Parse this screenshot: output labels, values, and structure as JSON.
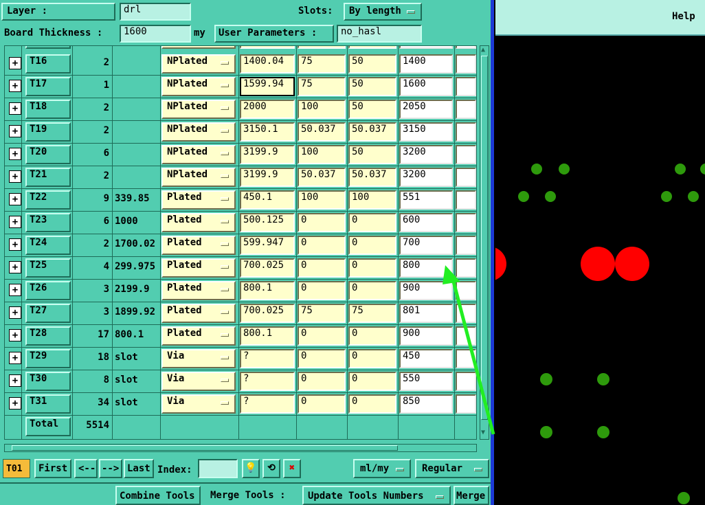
{
  "header": {
    "layer_label": "Layer     :",
    "layer_value": "drl",
    "slots_label": "Slots:",
    "slots_value": "By length",
    "board_thickness_label": "Board Thickness :",
    "board_thickness_value": "1600",
    "thickness_unit": "my",
    "user_params_label": "User Parameters :",
    "user_params_value": "no_hasl",
    "help_label": "Help"
  },
  "table": {
    "rows": [
      {
        "tool": "T16",
        "count": "2",
        "size": "",
        "type": "NPlated",
        "c1": "1400.04",
        "c2": "75",
        "c3": "50",
        "c4": "1400"
      },
      {
        "tool": "T17",
        "count": "1",
        "size": "",
        "type": "NPlated",
        "c1": "1599.94",
        "c2": "75",
        "c3": "50",
        "c4": "1600"
      },
      {
        "tool": "T18",
        "count": "2",
        "size": "",
        "type": "NPlated",
        "c1": "2000",
        "c2": "100",
        "c3": "50",
        "c4": "2050"
      },
      {
        "tool": "T19",
        "count": "2",
        "size": "",
        "type": "NPlated",
        "c1": "3150.1",
        "c2": "50.037",
        "c3": "50.037",
        "c4": "3150"
      },
      {
        "tool": "T20",
        "count": "6",
        "size": "",
        "type": "NPlated",
        "c1": "3199.9",
        "c2": "100",
        "c3": "50",
        "c4": "3200"
      },
      {
        "tool": "T21",
        "count": "2",
        "size": "",
        "type": "NPlated",
        "c1": "3199.9",
        "c2": "50.037",
        "c3": "50.037",
        "c4": "3200"
      },
      {
        "tool": "T22",
        "count": "9",
        "size": "339.85",
        "type": "Plated",
        "c1": "450.1",
        "c2": "100",
        "c3": "100",
        "c4": "551"
      },
      {
        "tool": "T23",
        "count": "6",
        "size": "1000",
        "type": "Plated",
        "c1": "500.125",
        "c2": "0",
        "c3": "0",
        "c4": "600"
      },
      {
        "tool": "T24",
        "count": "2",
        "size": "1700.02",
        "type": "Plated",
        "c1": "599.947",
        "c2": "0",
        "c3": "0",
        "c4": "700"
      },
      {
        "tool": "T25",
        "count": "4",
        "size": "299.975",
        "type": "Plated",
        "c1": "700.025",
        "c2": "0",
        "c3": "0",
        "c4": "800"
      },
      {
        "tool": "T26",
        "count": "3",
        "size": "2199.9",
        "type": "Plated",
        "c1": "800.1",
        "c2": "0",
        "c3": "0",
        "c4": "900"
      },
      {
        "tool": "T27",
        "count": "3",
        "size": "1899.92",
        "type": "Plated",
        "c1": "700.025",
        "c2": "75",
        "c3": "75",
        "c4": "801"
      },
      {
        "tool": "T28",
        "count": "17",
        "size": "800.1",
        "type": "Plated",
        "c1": "800.1",
        "c2": "0",
        "c3": "0",
        "c4": "900"
      },
      {
        "tool": "T29",
        "count": "18",
        "size": "slot",
        "type": "Via",
        "c1": "?",
        "c2": "0",
        "c3": "0",
        "c4": "450"
      },
      {
        "tool": "T30",
        "count": "8",
        "size": "slot",
        "type": "Via",
        "c1": "?",
        "c2": "0",
        "c3": "0",
        "c4": "550"
      },
      {
        "tool": "T31",
        "count": "34",
        "size": "slot",
        "type": "Via",
        "c1": "?",
        "c2": "0",
        "c3": "0",
        "c4": "850"
      }
    ],
    "total_label": "Total",
    "total_value": "5514"
  },
  "nav": {
    "current_tool": "T01",
    "first": "First",
    "prev": "<--",
    "next": "-->",
    "last": "Last",
    "index_label": "Index:",
    "index_value": "",
    "units_value": "ml/my",
    "mode_value": "Regular"
  },
  "bottom": {
    "combine_tools": "Combine Tools",
    "merge_tools_label": "Merge Tools :",
    "merge_mode": "Update Tools Numbers",
    "merge_button": "Merge"
  },
  "colors": {
    "panel_bg": "#52cdb0",
    "cell_yellow": "#ffffcc",
    "drill_green": "#2e9a0c",
    "drill_red": "#ff0000",
    "arrow": "#22ee22",
    "current_tool_bg": "#f5bb3a"
  }
}
